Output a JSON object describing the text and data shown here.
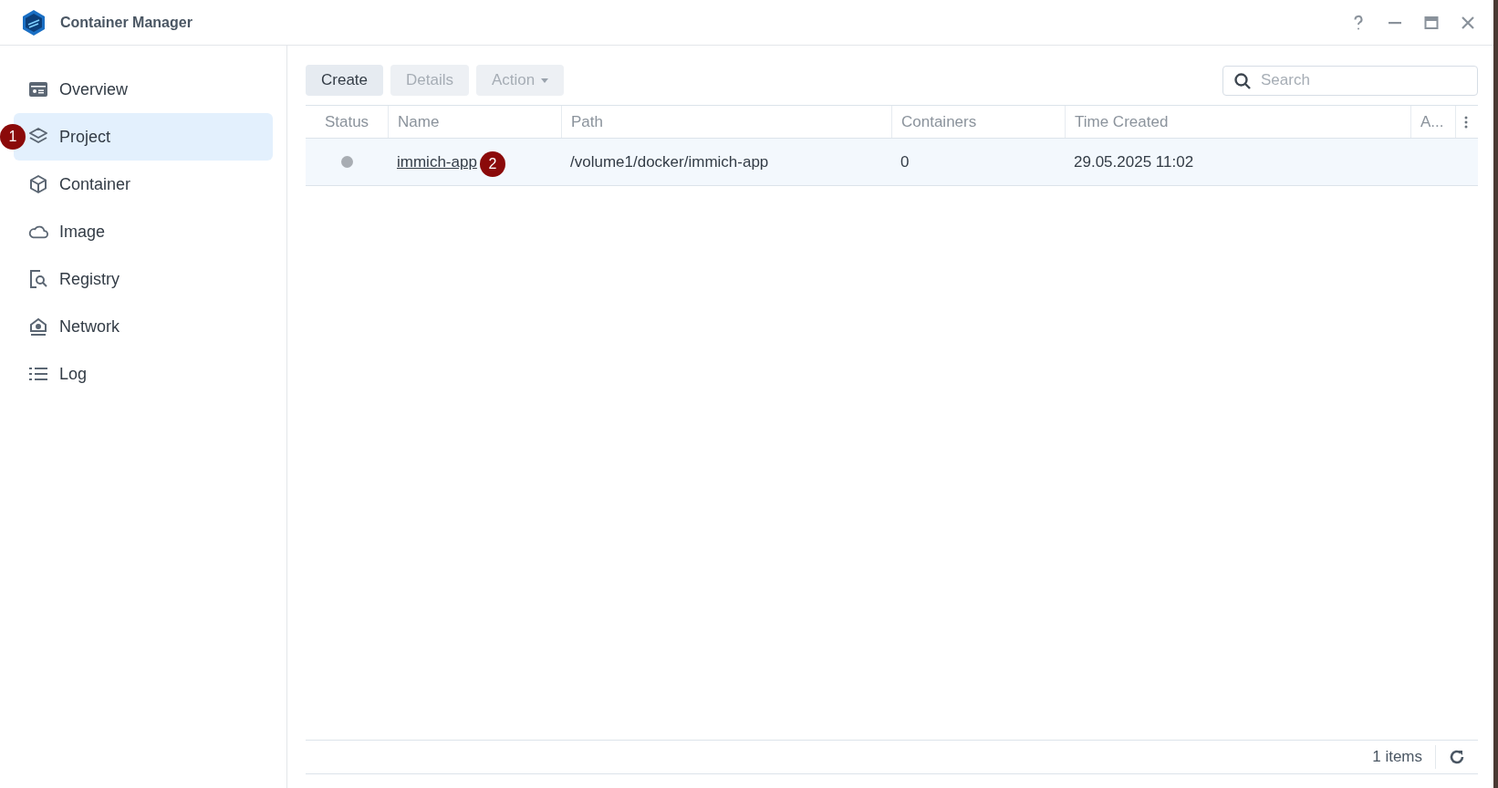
{
  "window": {
    "title": "Container Manager"
  },
  "sidebar": {
    "items": [
      {
        "label": "Overview",
        "selected": false
      },
      {
        "label": "Project",
        "selected": true,
        "badge": "1"
      },
      {
        "label": "Container",
        "selected": false
      },
      {
        "label": "Image",
        "selected": false
      },
      {
        "label": "Registry",
        "selected": false
      },
      {
        "label": "Network",
        "selected": false
      },
      {
        "label": "Log",
        "selected": false
      }
    ]
  },
  "toolbar": {
    "buttons": [
      {
        "label": "Create",
        "disabled": false,
        "dropdown": false
      },
      {
        "label": "Details",
        "disabled": true,
        "dropdown": false
      },
      {
        "label": "Action",
        "disabled": true,
        "dropdown": true
      }
    ],
    "search": {
      "placeholder": "Search"
    }
  },
  "table": {
    "columns": [
      "Status",
      "Name",
      "Path",
      "Containers",
      "Time Created",
      "A..."
    ],
    "rows": [
      {
        "running": false,
        "name": "immich-app",
        "badge": "2",
        "path": "/volume1/docker/immich-app",
        "containers": "0",
        "time_created": "29.05.2025 11:02",
        "selected": true
      }
    ]
  },
  "status_bar": {
    "count": "1 items"
  }
}
